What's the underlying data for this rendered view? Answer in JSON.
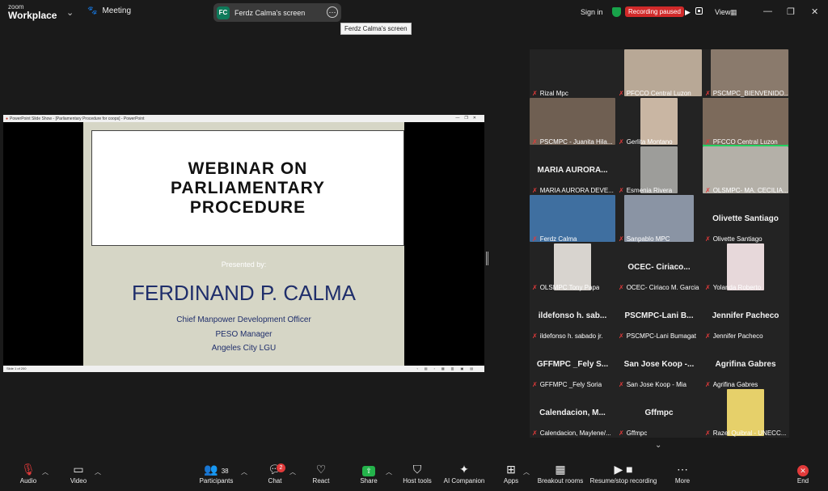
{
  "topbar": {
    "brand_line1": "zoom",
    "brand_line2": "Workplace",
    "meeting_label": "Meeting",
    "share_initials": "FC",
    "share_title": "Ferdz Calma's screen",
    "share_tooltip": "Ferdz Calma's screen",
    "signin": "Sign in",
    "recording_status": "Recording paused",
    "view_label": "View"
  },
  "ppt": {
    "window_title": "PowerPoint Slide Show - [Parliamentary Procedure for coops] - PowerPoint",
    "status": "Slide 1 of 200"
  },
  "slide": {
    "title_lines": [
      "WEBINAR ON",
      "PARLIAMENTARY",
      "PROCEDURE"
    ],
    "presented_by": "Presented by:",
    "speaker": "FERDINAND P. CALMA",
    "roles": [
      "Chief Manpower Development Officer",
      "PESO Manager",
      "Angeles City LGU"
    ]
  },
  "participants": [
    {
      "label": "Rizal Mpc",
      "name": ""
    },
    {
      "label": "PFCCO Central Luzon",
      "name": ""
    },
    {
      "label": "PSCMPC_BIENVENIDO...",
      "name": ""
    },
    {
      "label": "PSCMPC - Juanita Hila...",
      "name": ""
    },
    {
      "label": "Gerlita Montano",
      "name": ""
    },
    {
      "label": "PFCCO Central Luzon",
      "name": ""
    },
    {
      "label": "MARIA AURORA DEVE...",
      "name": "MARIA  AURORA..."
    },
    {
      "label": "Esmenia Rivera",
      "name": ""
    },
    {
      "label": "OLSMPC- MA. CECILIA...",
      "name": ""
    },
    {
      "label": "Ferdz Calma",
      "name": ""
    },
    {
      "label": "Sanpablo MPC",
      "name": ""
    },
    {
      "label": "Olivette Santiago",
      "name": "Olivette Santiago"
    },
    {
      "label": "OLSMPC Tony Papa",
      "name": ""
    },
    {
      "label": "OCEC- Ciriaco M. Garcia",
      "name": "OCEC-  Ciriaco..."
    },
    {
      "label": "Yolanda Roberto",
      "name": ""
    },
    {
      "label": "ildefonso h. sabado jr.",
      "name": "ildefonso  h. sab..."
    },
    {
      "label": "PSCMPC-Lani Bumagat",
      "name": "PSCMPC-Lani B..."
    },
    {
      "label": "Jennifer Pacheco",
      "name": "Jennifer Pacheco"
    },
    {
      "label": "GFFMPC _Fely Soria",
      "name": "GFFMPC  _Fely S..."
    },
    {
      "label": "San Jose Koop - Mia",
      "name": "San Jose Koop -..."
    },
    {
      "label": "Agrifina Gabres",
      "name": "Agrifina Gabres"
    },
    {
      "label": "Calendacion, Maylene/...",
      "name": "Calendacion,  M..."
    },
    {
      "label": "Gffmpc",
      "name": "Gffmpc"
    },
    {
      "label": "Razel Quibral - UNECC...",
      "name": ""
    }
  ],
  "toolbar": {
    "audio": "Audio",
    "video": "Video",
    "participants": "Participants",
    "participants_count": "38",
    "chat": "Chat",
    "chat_badge": "2",
    "react": "React",
    "share": "Share",
    "host_tools": "Host tools",
    "ai_companion": "AI Companion",
    "apps": "Apps",
    "breakout": "Breakout rooms",
    "record": "Resume/stop recording",
    "more": "More",
    "end": "End"
  }
}
